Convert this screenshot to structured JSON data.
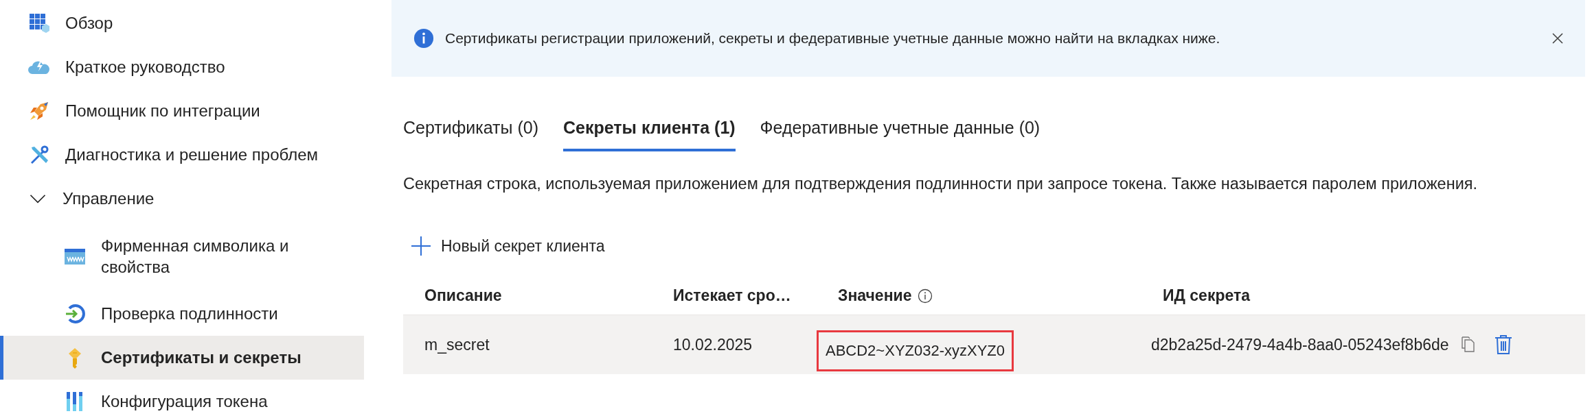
{
  "sidebar": {
    "items": [
      {
        "label": "Обзор",
        "selected": false
      },
      {
        "label": "Краткое руководство",
        "selected": false
      },
      {
        "label": "Помощник по интеграции",
        "selected": false
      },
      {
        "label": "Диагностика и решение проблем",
        "selected": false
      },
      {
        "label": "Управление",
        "selected": false,
        "expanded": true,
        "children": [
          {
            "label": "Фирменная символика и свойства",
            "selected": false
          },
          {
            "label": "Проверка подлинности",
            "selected": false
          },
          {
            "label": "Сертификаты и секреты",
            "selected": true
          },
          {
            "label": "Конфигурация токена",
            "selected": false
          }
        ]
      }
    ]
  },
  "banner": {
    "text": "Сертификаты регистрации приложений, секреты и федеративные учетные данные можно найти на вкладках ниже."
  },
  "tabs": [
    {
      "label": "Сертификаты (0)",
      "selected": false
    },
    {
      "label": "Секреты клиента (1)",
      "selected": true
    },
    {
      "label": "Федеративные учетные данные (0)",
      "selected": false
    }
  ],
  "description": "Секретная строка, используемая приложением для подтверждения подлинности при запросе токена. Также называется паролем приложения.",
  "new_button": {
    "label": "Новый секрет клиента"
  },
  "table": {
    "columns": [
      "Описание",
      "Истекает сро…",
      "Значение",
      "ИД секрета"
    ],
    "rows": [
      {
        "description": "m_secret",
        "expires": "10.02.2025",
        "value": "ABCD2~XYZ032-xyzXYZ0",
        "value_highlighted": true,
        "secret_id": "d2b2a25d-2479-4a4b-8aa0-05243ef8b6de"
      }
    ]
  }
}
